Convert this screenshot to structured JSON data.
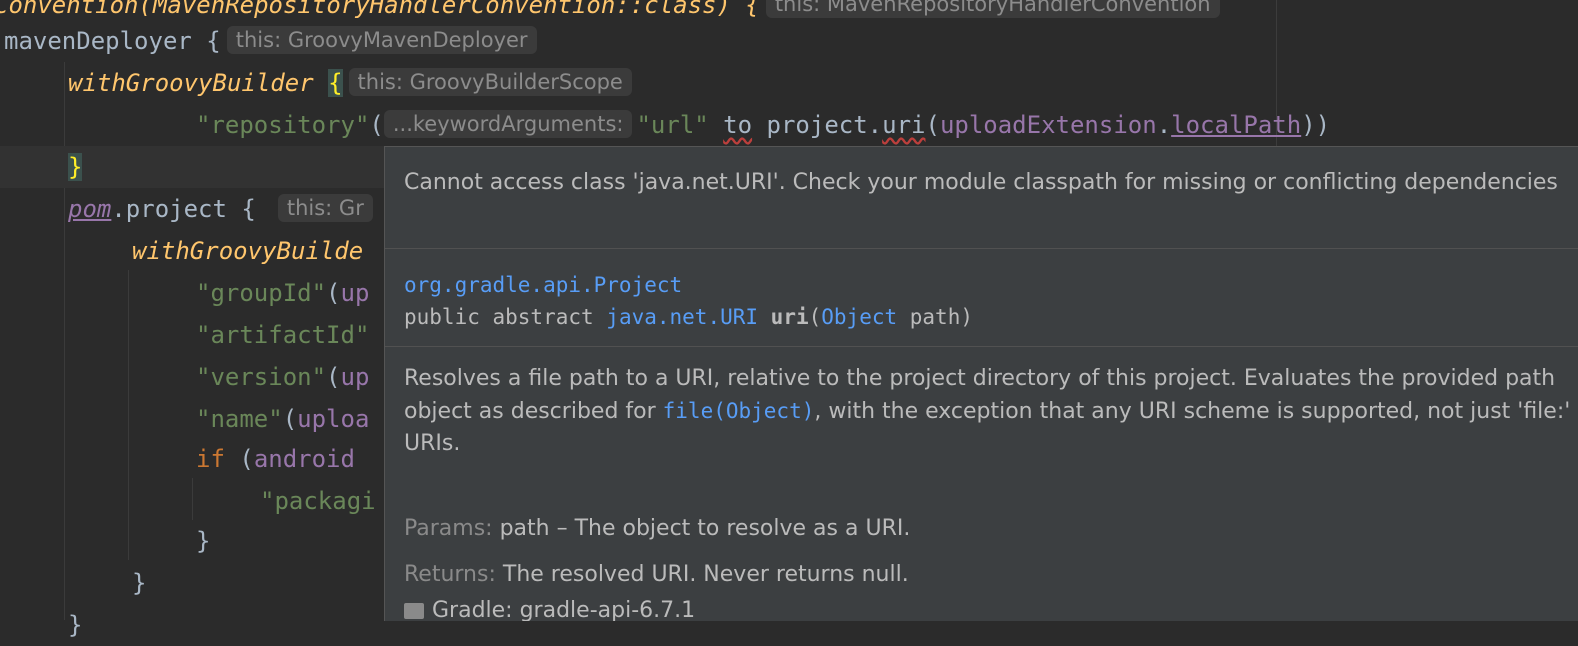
{
  "code": {
    "line0": {
      "text": "Convention(MavenRepositoryHandlerConvention::class) {",
      "hint": "this: MavenRepositoryHandlerConvention"
    },
    "line1": {
      "name": "mavenDeployer",
      "brace": " {",
      "hint": "this: GroovyMavenDeployer"
    },
    "line2": {
      "name": "withGroovyBuilder",
      "brace": "{",
      "hint": "this: GroovyBuilderScope"
    },
    "line3": {
      "str": "\"repository\"",
      "paren": "(",
      "hint": "...keywordArguments:",
      "url": "\"url\"",
      "to": "to",
      "project": " project.",
      "uri": "uri",
      "open": "(",
      "ext": "uploadExtension",
      "dot": ".",
      "local": "localPath",
      "close": "))"
    },
    "line4": {
      "brace": "}"
    },
    "line5": {
      "pom": "pom",
      "rest": ".project {",
      "hint": "this: Gr"
    },
    "line6": {
      "name": "withGroovyBuilde"
    },
    "line7": {
      "str": "\"groupId\"",
      "paren": "(",
      "rest": "up"
    },
    "line8": {
      "str": "\"artifactId\""
    },
    "line9": {
      "str": "\"version\"",
      "paren": "(",
      "rest": "up"
    },
    "line10": {
      "str": "\"name\"",
      "paren": "(",
      "rest": "uploa"
    },
    "line11": {
      "kw": "if",
      "paren": " (",
      "rest": "android"
    },
    "line12": {
      "str": "\"packagi"
    },
    "line13": {
      "brace": "}"
    },
    "line14": {
      "brace": "}"
    },
    "line15": {
      "brace": "}"
    }
  },
  "popup": {
    "error": "Cannot access class 'java.net.URI'. Check your module classpath for missing or conflicting dependencies",
    "signature": {
      "class": "org.gradle.api.Project",
      "modifiers": "public abstract ",
      "return_type": "java.net.URI",
      "method": "uri",
      "open": "(",
      "param_type": "Object",
      "param_rest": " path)"
    },
    "description": {
      "part1": "Resolves a file path to a URI, relative to the project directory of this project. Evaluates the provided path object as described for ",
      "link": "file(Object)",
      "part2": ", with the exception that any URI scheme is supported, not just 'file:' URIs."
    },
    "params": {
      "label": "Params:",
      "text": "path – The object to resolve as a URI."
    },
    "returns": {
      "label": "Returns:",
      "text": "The resolved URI. Never returns null."
    },
    "footer": "Gradle: gradle-api-6.7.1"
  }
}
